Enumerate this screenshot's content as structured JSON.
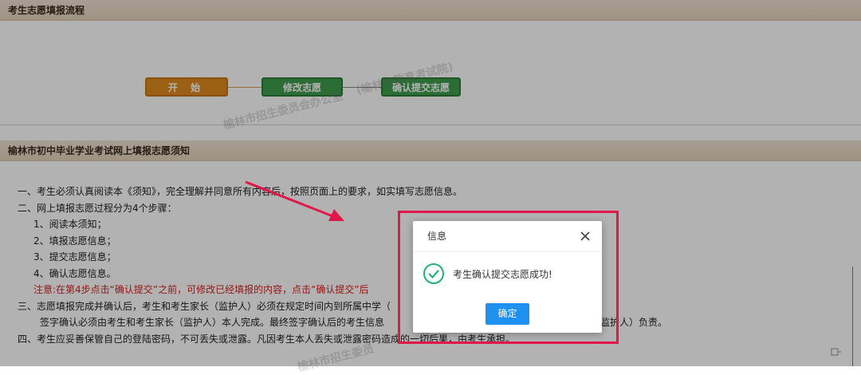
{
  "flow_section": {
    "title": "考生志愿填报流程",
    "nodes": {
      "start": "开 始",
      "modify": "修改志愿",
      "confirm": "确认提交志愿"
    }
  },
  "notice_section": {
    "title": "榆林市初中毕业学业考试网上填报志愿须知",
    "lines": {
      "l1": "一、考生必须认真阅读本《须知》，完全理解并同意所有内容后，按照页面上的要求，如实填写志愿信息。",
      "l2": "二、网上填报志愿过程分为4个步骤：",
      "s1": "1、阅读本须知；",
      "s2": "2、填报志愿信息；",
      "s3": "3、提交志愿信息；",
      "s4": "4、确认志愿信息。",
      "warn": "注意:在第4步点击“确认提交”之前，可修改已经填报的内容，点击“确认提交”后",
      "l3": "三、志愿填报完成并确认后，考生和考生家长（监护人）必须在规定时间内到所属中学（",
      "l3b_left": "签字确认必须由考生和考生家长（监护人）本人完成。最终签字确认后的考生信息",
      "l3b_right": "（监护人）负责。",
      "l4": "四、考生应妥善保管自己的登陆密码，不可丢失或泄露。凡因考生本人丢失或泄露密码造成的一切后果，由考生承担。"
    }
  },
  "watermarks": {
    "w1": "(榆林市教育考试院)",
    "w2": "榆林市招生委员会办公室",
    "w3": "室（榆林市教育考试院）",
    "w4": "榆林市招生委员"
  },
  "dialog": {
    "title": "信息",
    "message": "考生确认提交志愿成功!",
    "ok_label": "确定",
    "close_icon": "close-icon",
    "status_icon": "check-circle-icon"
  },
  "colors": {
    "accent_green": "#3f9b4d",
    "accent_orange": "#e08a1e",
    "warning_red": "#d8201e",
    "highlight": "#e0184a",
    "button_blue": "#1e90f0"
  }
}
